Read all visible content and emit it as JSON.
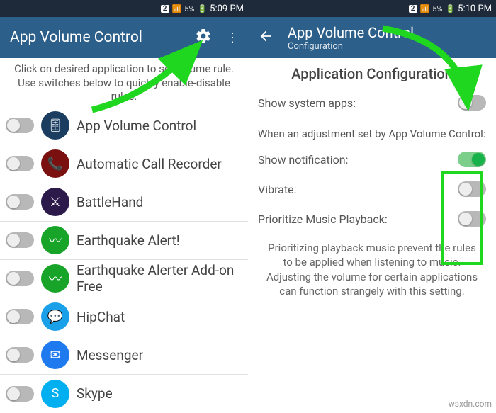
{
  "left": {
    "statusbar": {
      "sim": "2",
      "battery": "5%",
      "time": "5:09 PM"
    },
    "appbar": {
      "title": "App Volume Control"
    },
    "instructions": "Click on desired application to set volume rule. Use switches below to quickly enable-disable rules.",
    "apps": [
      {
        "name": "App Volume Control",
        "bg": "#1b3d60",
        "emoji": "🎚"
      },
      {
        "name": "Automatic Call Recorder",
        "bg": "#7a1010",
        "emoji": "📞"
      },
      {
        "name": "BattleHand",
        "bg": "#2b1a4a",
        "emoji": "⚔"
      },
      {
        "name": "Earthquake Alert!",
        "bg": "#18a428",
        "emoji": "〰"
      },
      {
        "name": "Earthquake Alerter Add-on Free",
        "bg": "#18a428",
        "emoji": "〰"
      },
      {
        "name": "HipChat",
        "bg": "#1aa0e8",
        "emoji": "💬"
      },
      {
        "name": "Messenger",
        "bg": "#1f7af0",
        "emoji": "✉"
      },
      {
        "name": "Skype",
        "bg": "#00aff0",
        "emoji": "S"
      }
    ]
  },
  "right": {
    "statusbar": {
      "sim": "2",
      "battery": "5%",
      "time": "5:10 PM"
    },
    "appbar": {
      "title": "App Volume Control",
      "subtitle": "Configuration"
    },
    "section": "Application Configuration",
    "rows": {
      "show_system": {
        "label": "Show system apps:",
        "on": false
      },
      "group": "When an adjustment set by App Volume Control:",
      "show_notif": {
        "label": "Show notification:",
        "on": true
      },
      "vibrate": {
        "label": "Vibrate:",
        "on": false
      },
      "prioritize": {
        "label": "Prioritize Music Playback:",
        "on": false
      }
    },
    "help": "Prioritizing playback music prevent the rules to be applied when listening to music. Adjusting the volume for certain applications can function strangely with this setting."
  },
  "watermark": "wsxdn.com"
}
